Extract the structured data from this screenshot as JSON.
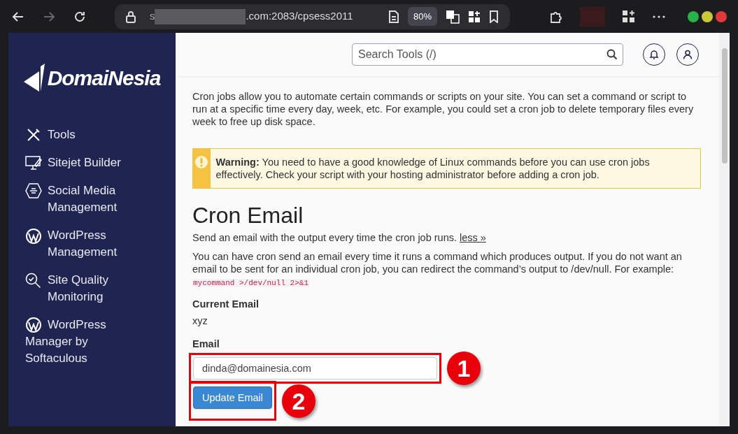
{
  "browser": {
    "url_start": "s",
    "url_end": ".com:2083/cpsess2011",
    "zoom": "80%"
  },
  "logo": {
    "text": "DomaiNesia"
  },
  "sidebar": {
    "items": [
      {
        "kind": "tools",
        "label": "Tools"
      },
      {
        "kind": "monitor",
        "label": "Sitejet Builder"
      },
      {
        "kind": "social",
        "label": "Social Media Management"
      },
      {
        "kind": "wordpress",
        "label": "WordPress Management"
      },
      {
        "kind": "quality",
        "label": "Site Quality Monitoring"
      },
      {
        "kind": "wordpress",
        "label": "WordPress Manager by Softaculous"
      }
    ]
  },
  "search": {
    "placeholder": "Search Tools (/)"
  },
  "intro": "Cron jobs allow you to automate certain commands or scripts on your site. You can set a command or script to run at a specific time every day, week, etc. For example, you could set a cron job to delete temporary files every week to free up disk space.",
  "warning": {
    "text": "**Warning:** You need to have a good knowledge of Linux commands before you can use cron jobs effectively. Check your script with your hosting administrator before adding a cron job."
  },
  "section": {
    "title": "Cron Email",
    "summary": "Send an email with the output every time the cron job runs.",
    "link": "less »",
    "details": "You can have cron send an email every time it runs a command which produces output. If you do not want an email to be sent for an individual cron job, you can redirect the command’s output to /dev/null. For example:",
    "code": "mycommand >/dev/null 2>&1",
    "current_label": "Current Email",
    "current_value": "xyz",
    "email_label": "Email",
    "email_value": "dinda@domainesia.com",
    "button": "Update Email"
  },
  "callouts": [
    "1",
    "2"
  ]
}
